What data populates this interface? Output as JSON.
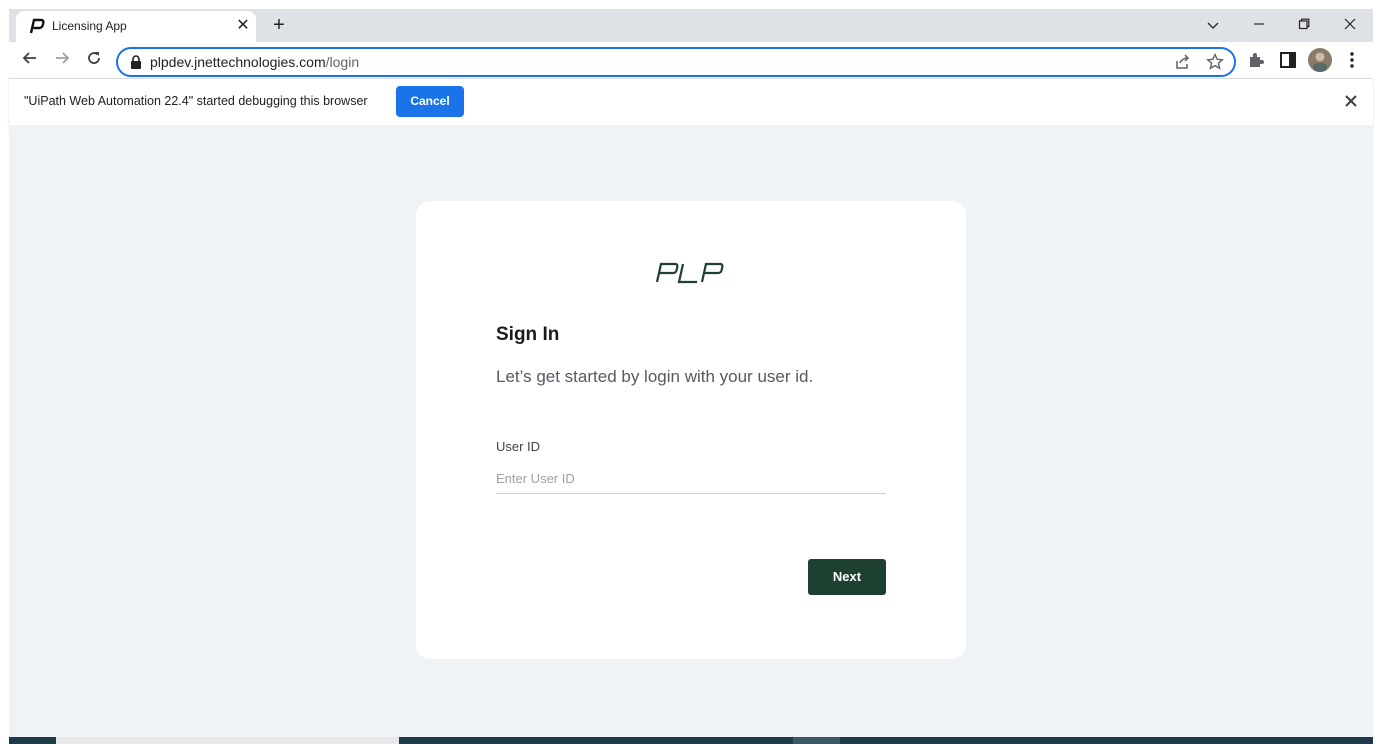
{
  "browser": {
    "tab": {
      "title": "Licensing App"
    },
    "address": {
      "host": "plpdev.jnettechnologies.com",
      "path": "/login"
    }
  },
  "infobar": {
    "message": "\"UiPath Web Automation 22.4\" started debugging this browser",
    "cancel_label": "Cancel"
  },
  "login": {
    "logo_text": "PLP",
    "title": "Sign In",
    "subtitle": "Let’s get started by login with your user id.",
    "user_id_label": "User ID",
    "user_id_placeholder": "Enter User ID",
    "user_id_value": "",
    "next_label": "Next"
  },
  "colors": {
    "accent": "#1a73e8",
    "brand": "#1d4031",
    "page_bg": "#f0f3f5"
  }
}
